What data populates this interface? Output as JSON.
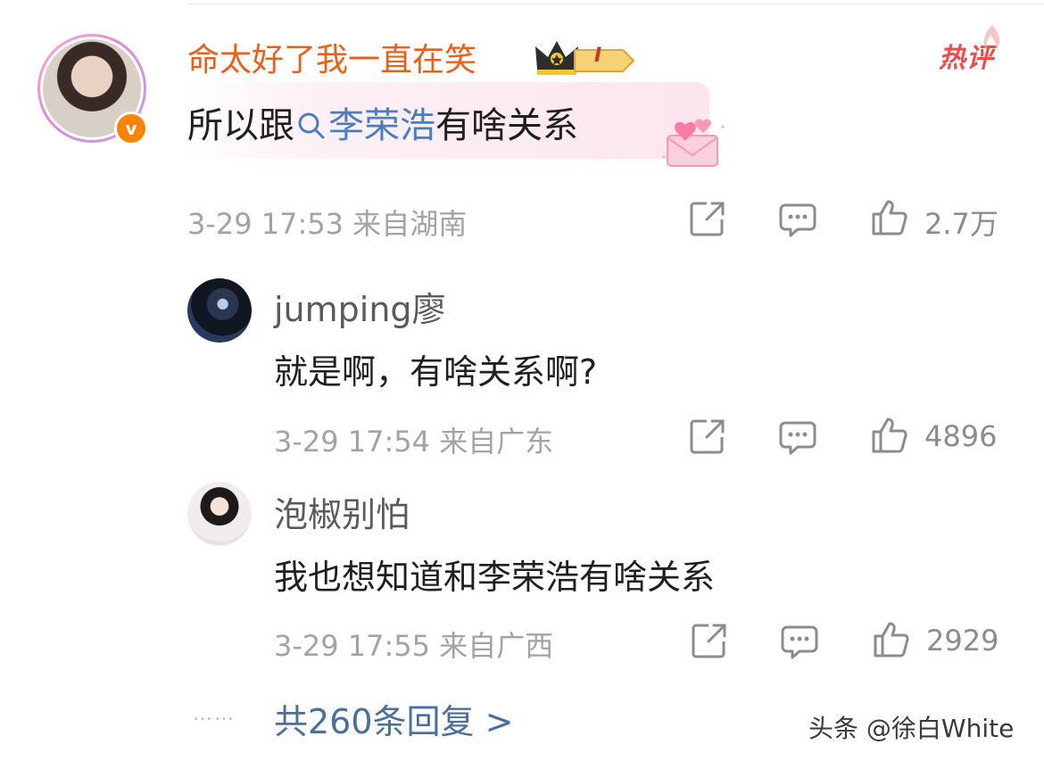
{
  "main_comment": {
    "username": "命太好了我一直在笑",
    "level_badge": "I",
    "hot_tag": "热评",
    "text_prefix": "所以跟",
    "link_text": "李荣浩",
    "text_suffix": "有啥关系",
    "meta": "3-29 17:53 来自湖南",
    "likes": "2.7万",
    "colors": {
      "username": "#e8611a",
      "link": "#4b7dbf",
      "hot_tag": "#f04c4c"
    }
  },
  "replies": [
    {
      "username": "jumping廖",
      "text": "就是啊，有啥关系啊?",
      "meta": "3-29 17:54 来自广东",
      "likes": "4896"
    },
    {
      "username": "泡椒别怕",
      "text": "我也想知道和李荣浩有啥关系",
      "meta": "3-29 17:55 来自广西",
      "likes": "2929"
    }
  ],
  "more_dots": "……",
  "more_replies": "共260条回复 >",
  "watermark": "头条 @徐白White",
  "icons": [
    "share-icon",
    "comment-icon",
    "like-icon",
    "search-icon",
    "crown-icon",
    "verified-icon"
  ]
}
